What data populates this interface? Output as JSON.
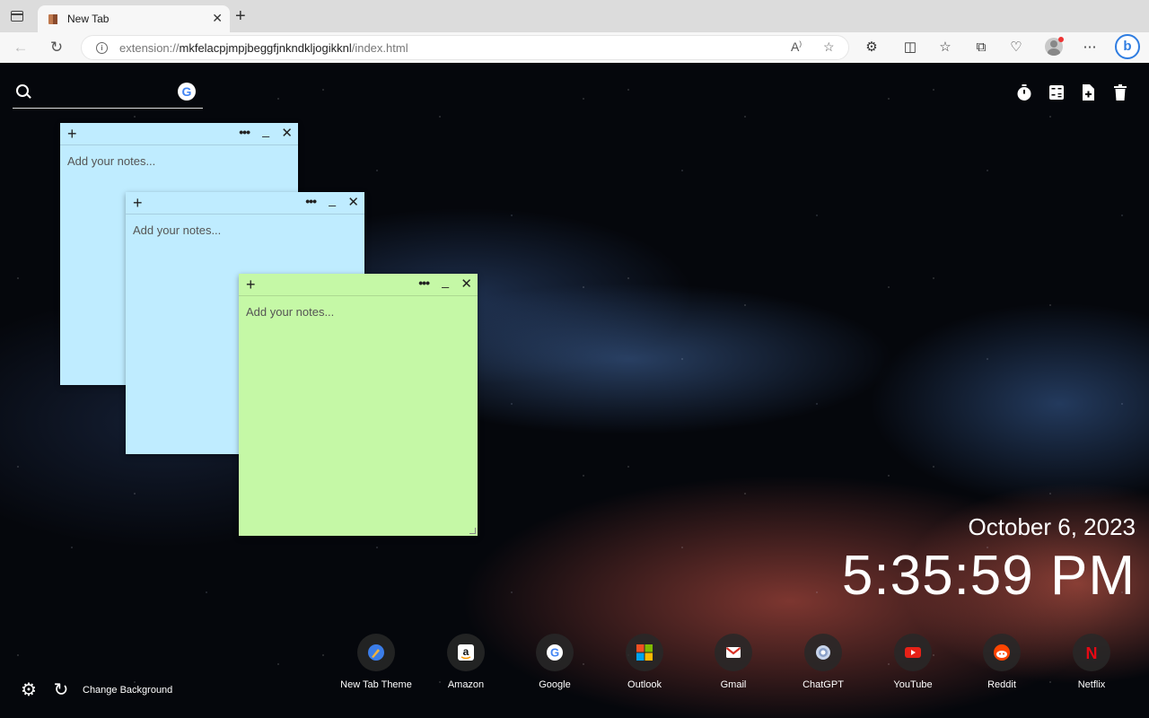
{
  "browser": {
    "tab_title": "New Tab",
    "url_scheme": "extension://",
    "url_host": "mkfelacpjmpjbeggfjnkndkljogikknl",
    "url_path": "/index.html"
  },
  "search": {
    "placeholder": ""
  },
  "notes": [
    {
      "placeholder": "Add your notes...",
      "color": "#bfecff"
    },
    {
      "placeholder": "Add your notes...",
      "color": "#bfecff"
    },
    {
      "placeholder": "Add your notes...",
      "color": "#c5f8a6"
    }
  ],
  "clock": {
    "date": "October 6, 2023",
    "time": "5:35:59 PM"
  },
  "shortcuts": [
    {
      "label": "New Tab Theme",
      "icon": "brush-icon"
    },
    {
      "label": "Amazon",
      "icon": "amazon-icon"
    },
    {
      "label": "Google",
      "icon": "google-icon"
    },
    {
      "label": "Outlook",
      "icon": "microsoft-icon"
    },
    {
      "label": "Gmail",
      "icon": "gmail-icon"
    },
    {
      "label": "ChatGPT",
      "icon": "chatgpt-icon"
    },
    {
      "label": "YouTube",
      "icon": "youtube-icon"
    },
    {
      "label": "Reddit",
      "icon": "reddit-icon"
    },
    {
      "label": "Netflix",
      "icon": "netflix-icon"
    }
  ],
  "footer": {
    "change_background": "Change Background"
  }
}
